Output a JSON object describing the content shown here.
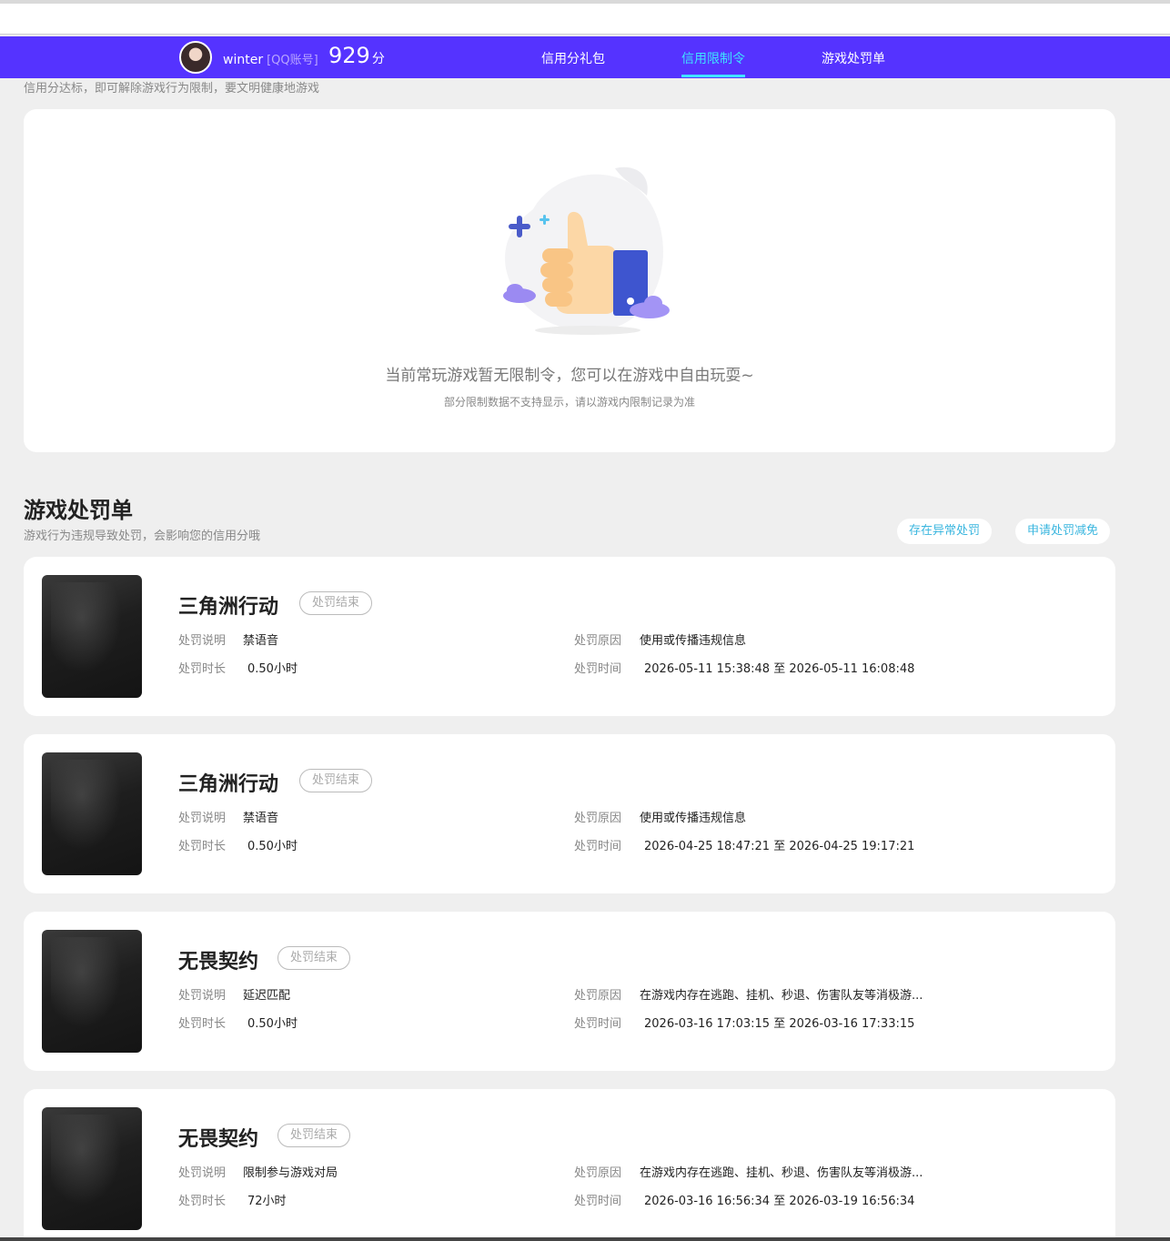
{
  "header": {
    "username": "winter",
    "account_type": "[QQ账号]",
    "score": "929",
    "score_unit": "分",
    "tabs": [
      {
        "label": "信用分礼包"
      },
      {
        "label": "信用限制令"
      },
      {
        "label": "游戏处罚单"
      }
    ]
  },
  "restriction": {
    "subtitle": "信用分达标，即可解除游戏行为限制，要文明健康地游戏",
    "empty_title": "当前常玩游戏暂无限制令，您可以在游戏中自由玩耍~",
    "empty_note": "部分限制数据不支持显示，请以游戏内限制记录为准"
  },
  "penalty": {
    "title": "游戏处罚单",
    "subtitle": "游戏行为违规导致处罚，会影响您的信用分哦",
    "btn_abnormal": "存在异常处罚",
    "btn_appeal": "申请处罚减免",
    "labels": {
      "desc": "处罚说明",
      "duration": "处罚时长",
      "reason": "处罚原因",
      "time": "处罚时间"
    },
    "items": [
      {
        "game": "三角洲行动",
        "status": "处罚结束",
        "desc": "禁语音",
        "duration": "0.50小时",
        "reason": "使用或传播违规信息",
        "time": "2026-05-11 15:38:48 至 2026-05-11 16:08:48"
      },
      {
        "game": "三角洲行动",
        "status": "处罚结束",
        "desc": "禁语音",
        "duration": "0.50小时",
        "reason": "使用或传播违规信息",
        "time": "2026-04-25 18:47:21 至 2026-04-25 19:17:21"
      },
      {
        "game": "无畏契约",
        "status": "处罚结束",
        "desc": "延迟匹配",
        "duration": "0.50小时",
        "reason": "在游戏内存在逃跑、挂机、秒退、伤害队友等消极游...",
        "time": "2026-03-16 17:03:15 至 2026-03-16 17:33:15"
      },
      {
        "game": "无畏契约",
        "status": "处罚结束",
        "desc": "限制参与游戏对局",
        "duration": "72小时",
        "reason": "在游戏内存在逃跑、挂机、秒退、伤害队友等消极游...",
        "time": "2026-03-16 16:56:34 至 2026-03-19 16:56:34"
      }
    ]
  },
  "colors": {
    "nav_bg": "#5533ff",
    "nav_active": "#3fe3ff",
    "link": "#3ab6df",
    "page_bg": "#efefef"
  }
}
